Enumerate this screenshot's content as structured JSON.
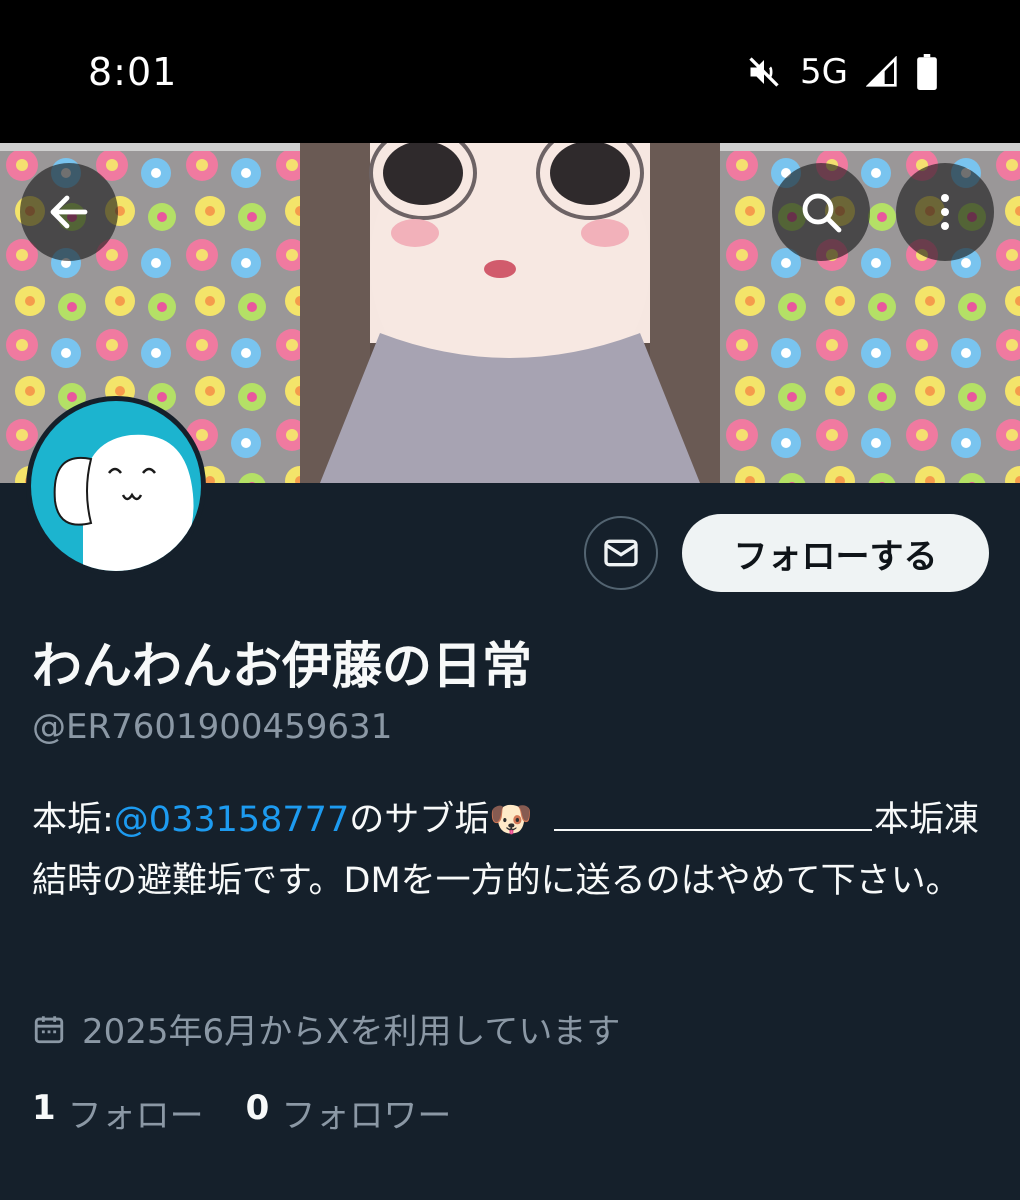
{
  "status_bar": {
    "time": "8:01",
    "network": "5G",
    "icons": [
      "mute-icon",
      "signal-icon",
      "battery-icon"
    ]
  },
  "header": {
    "back_icon": "arrow-left-icon",
    "search_icon": "search-icon",
    "more_icon": "more-vertical-icon"
  },
  "profile": {
    "display_name": "わんわんお伊藤の日常",
    "handle": "@ER7601900459631",
    "dm_icon": "mail-icon",
    "follow_label": "フォローする",
    "bio": {
      "prefix": "本垢:",
      "mention": "@033158777",
      "after_mention": "のサブ垢🐶 ",
      "after_line": "本垢凍結時の避難垢です。DMを一方的に送るのはやめて下さい。"
    },
    "joined": "2025年6月からXを利用しています",
    "following_count": "1",
    "following_label": "フォロー",
    "followers_count": "0",
    "followers_label": "フォロワー"
  },
  "colors": {
    "background": "#15202b",
    "accent": "#1d9bf0",
    "secondary_text": "#8b98a5",
    "avatar_bg": "#1cb4cf"
  }
}
